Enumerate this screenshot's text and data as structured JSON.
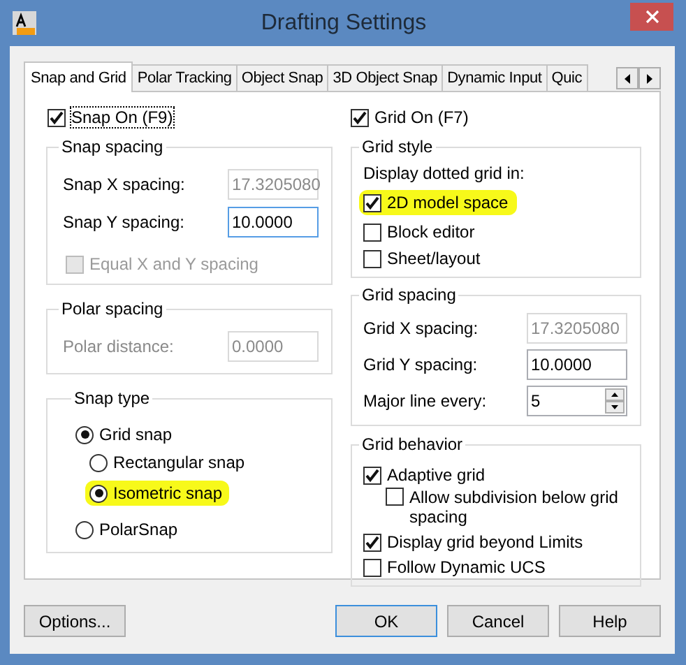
{
  "window": {
    "title": "Drafting Settings"
  },
  "tabs": [
    {
      "label": "Snap and Grid",
      "selected": true
    },
    {
      "label": "Polar Tracking",
      "selected": false
    },
    {
      "label": "Object Snap",
      "selected": false
    },
    {
      "label": "3D Object Snap",
      "selected": false
    },
    {
      "label": "Dynamic Input",
      "selected": false
    },
    {
      "label": "Quic",
      "selected": false
    }
  ],
  "snap_on": {
    "label": "Snap On (F9)",
    "checked": true,
    "focused": true
  },
  "snap_spacing": {
    "title": "Snap spacing",
    "fields": [
      {
        "label": "Snap X spacing:",
        "value": "17.3205080",
        "disabled": true,
        "focused": false
      },
      {
        "label": "Snap Y spacing:",
        "value": "10.0000",
        "disabled": false,
        "focused": true
      }
    ],
    "equal": {
      "label": "Equal X and Y spacing",
      "checked": false,
      "disabled": true
    }
  },
  "polar_spacing": {
    "title": "Polar spacing",
    "fields": [
      {
        "label": "Polar distance:",
        "value": "0.0000",
        "disabled": true,
        "focused": false
      }
    ]
  },
  "snap_type": {
    "title": "Snap type",
    "options": [
      {
        "label": "Grid snap",
        "selected": true,
        "highlighted": false,
        "children": [
          {
            "label": "Rectangular snap",
            "selected": false,
            "highlighted": false
          },
          {
            "label": "Isometric snap",
            "selected": true,
            "highlighted": true
          }
        ]
      },
      {
        "label": "PolarSnap",
        "selected": false,
        "highlighted": false
      }
    ]
  },
  "grid_on": {
    "label": "Grid On (F7)",
    "checked": true,
    "focused": false
  },
  "grid_style": {
    "title": "Grid style",
    "caption": "Display dotted grid in:",
    "options": [
      {
        "label": "2D model space",
        "checked": true,
        "highlighted": true
      },
      {
        "label": "Block editor",
        "checked": false,
        "highlighted": false
      },
      {
        "label": "Sheet/layout",
        "checked": false,
        "highlighted": false
      }
    ]
  },
  "grid_spacing": {
    "title": "Grid spacing",
    "fields": [
      {
        "label": "Grid X spacing:",
        "value": "17.3205080",
        "disabled": true,
        "focused": false,
        "kind": "text"
      },
      {
        "label": "Grid Y spacing:",
        "value": "10.0000",
        "disabled": false,
        "focused": false,
        "kind": "text"
      },
      {
        "label": "Major line every:",
        "value": "5",
        "disabled": false,
        "focused": false,
        "kind": "spinner"
      }
    ]
  },
  "grid_behavior": {
    "title": "Grid behavior",
    "options": [
      {
        "label": "Adaptive grid",
        "checked": true,
        "children": [
          {
            "label": "Allow subdivision below grid spacing",
            "checked": false
          }
        ]
      },
      {
        "label": "Display grid beyond Limits",
        "checked": true
      },
      {
        "label": "Follow Dynamic UCS",
        "checked": false
      }
    ]
  },
  "buttons": [
    {
      "label": "Options...",
      "default": false
    },
    {
      "label": "OK",
      "default": true
    },
    {
      "label": "Cancel",
      "default": false
    },
    {
      "label": "Help",
      "default": false
    }
  ]
}
